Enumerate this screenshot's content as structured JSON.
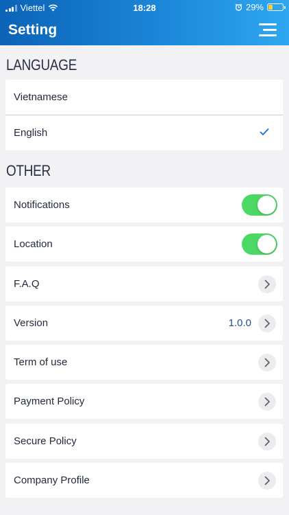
{
  "status_bar": {
    "carrier": "Viettel",
    "time": "18:28",
    "battery": "29%",
    "battery_level": 0.29
  },
  "header": {
    "title": "Setting"
  },
  "language": {
    "section_title": "LANGUAGE",
    "options": [
      {
        "label": "Vietnamese",
        "selected": false
      },
      {
        "label": "English",
        "selected": true
      }
    ]
  },
  "other": {
    "section_title": "OTHER",
    "items": [
      {
        "label": "Notifications",
        "control": "toggle",
        "on": true
      },
      {
        "label": "Location",
        "control": "toggle",
        "on": true
      },
      {
        "label": "F.A.Q",
        "control": "chevron"
      },
      {
        "label": "Version",
        "control": "chevron",
        "value": "1.0.0"
      },
      {
        "label": "Term of use",
        "control": "chevron"
      },
      {
        "label": "Payment Policy",
        "control": "chevron"
      },
      {
        "label": "Secure Policy",
        "control": "chevron"
      },
      {
        "label": "Company Profile",
        "control": "chevron"
      }
    ]
  },
  "colors": {
    "header_start": "#0b63b7",
    "header_end": "#2ea7f0",
    "toggle_on": "#4cd865",
    "check": "#1c6fd1",
    "version_value": "#1e4f8f"
  }
}
